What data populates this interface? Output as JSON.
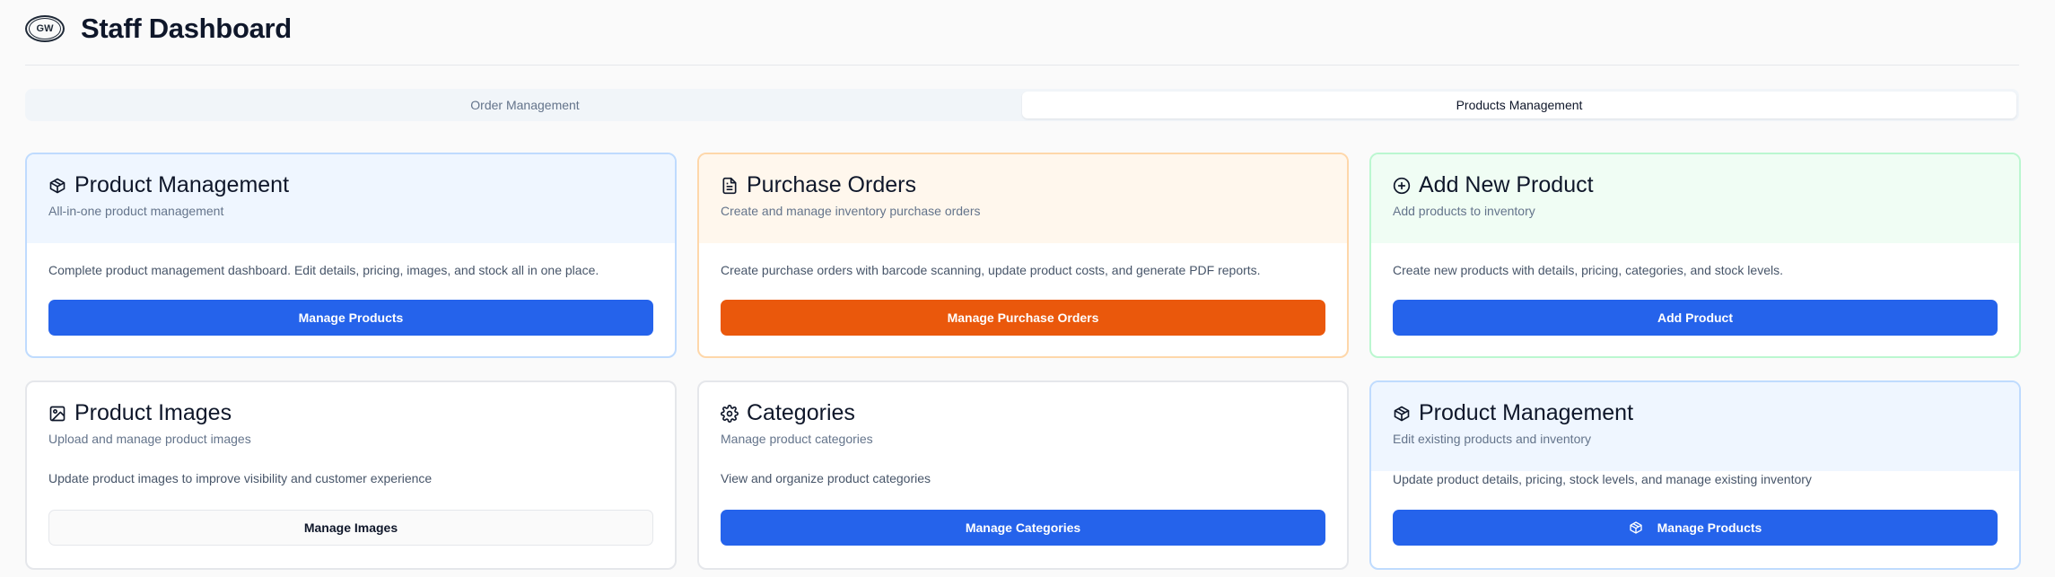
{
  "header": {
    "logo_text": "GW",
    "title": "Staff Dashboard"
  },
  "tabs": [
    {
      "label": "Order Management",
      "active": false
    },
    {
      "label": "Products Management",
      "active": true
    }
  ],
  "cards": [
    {
      "icon": "package-icon",
      "title": "Product Management",
      "subtitle": "All-in-one product management",
      "description": "Complete product management dashboard. Edit details, pricing, images, and stock all in one place.",
      "button": "Manage Products",
      "accent": "#bfdbfe",
      "header_bg": "#eff6ff",
      "button_color": "#2563eb"
    },
    {
      "icon": "file-text-icon",
      "title": "Purchase Orders",
      "subtitle": "Create and manage inventory purchase orders",
      "description": "Create purchase orders with barcode scanning, update product costs, and generate PDF reports.",
      "button": "Manage Purchase Orders",
      "accent": "#fed7aa",
      "header_bg": "#fff7ed",
      "button_color": "#ea580c"
    },
    {
      "icon": "plus-circle-icon",
      "title": "Add New Product",
      "subtitle": "Add products to inventory",
      "description": "Create new products with details, pricing, categories, and stock levels.",
      "button": "Add Product",
      "accent": "#bbf7d0",
      "header_bg": "#f0fdf4",
      "button_color": "#2563eb"
    },
    {
      "icon": "image-icon",
      "title": "Product Images",
      "subtitle": "Upload and manage product images",
      "description": "Update product images to improve visibility and customer experience",
      "button": "Manage Images",
      "button_style": "outline"
    },
    {
      "icon": "gear-icon",
      "title": "Categories",
      "subtitle": "Manage product categories",
      "description": "View and organize product categories",
      "button": "Manage Categories",
      "button_color": "#2563eb"
    },
    {
      "icon": "package-icon",
      "title": "Product Management",
      "subtitle": "Edit existing products and inventory",
      "description": "Update product details, pricing, stock levels, and manage existing inventory",
      "button": "Manage Products",
      "button_icon": "package-icon",
      "accent": "#bfdbfe",
      "header_bg": "#eff6ff",
      "button_color": "#2563eb"
    }
  ]
}
